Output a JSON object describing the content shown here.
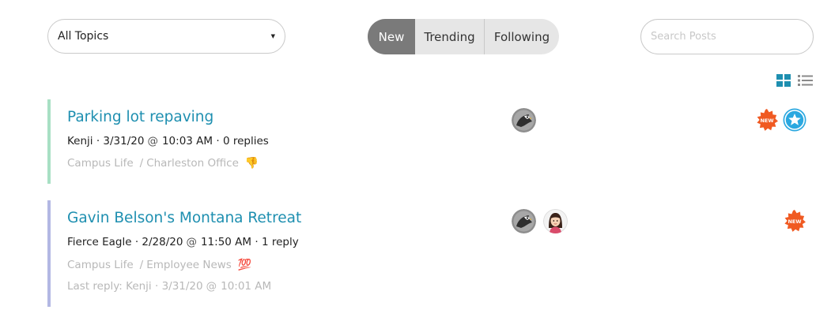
{
  "filters": {
    "topics_selected": "All Topics",
    "tabs": [
      "New",
      "Trending",
      "Following"
    ],
    "active_tab": "New",
    "search_placeholder": "Search Posts"
  },
  "view_modes": {
    "grid_icon": "grid-icon",
    "list_icon": "list-icon"
  },
  "posts": [
    {
      "title": "Parking lot repaving",
      "author": "Kenji",
      "date": "3/31/20",
      "at": "@",
      "time": "10:03 AM",
      "replies": "0 replies",
      "category": "Campus Life",
      "subcategory": "Charleston Office",
      "reaction": "👎",
      "bar_color": "#a8e0c4",
      "badge_new": "NEW"
    },
    {
      "title": "Gavin Belson's Montana Retreat",
      "author": "Fierce Eagle",
      "date": "2/28/20",
      "at": "@",
      "time": "11:50 AM",
      "replies": "1 reply",
      "category": "Campus Life",
      "subcategory": "Employee News",
      "reaction": "💯",
      "last_reply_prefix": "Last reply: Kenji",
      "last_reply_date": "3/31/20",
      "last_reply_at": "@",
      "last_reply_time": "10:01 AM",
      "bar_color": "#b3b8e3",
      "badge_new": "NEW"
    }
  ],
  "colors": {
    "accent": "#1e8fb0",
    "active_tab": "#7a7a7a",
    "star_badge": "#2ba8e0",
    "new_badge": "#f05a22"
  }
}
